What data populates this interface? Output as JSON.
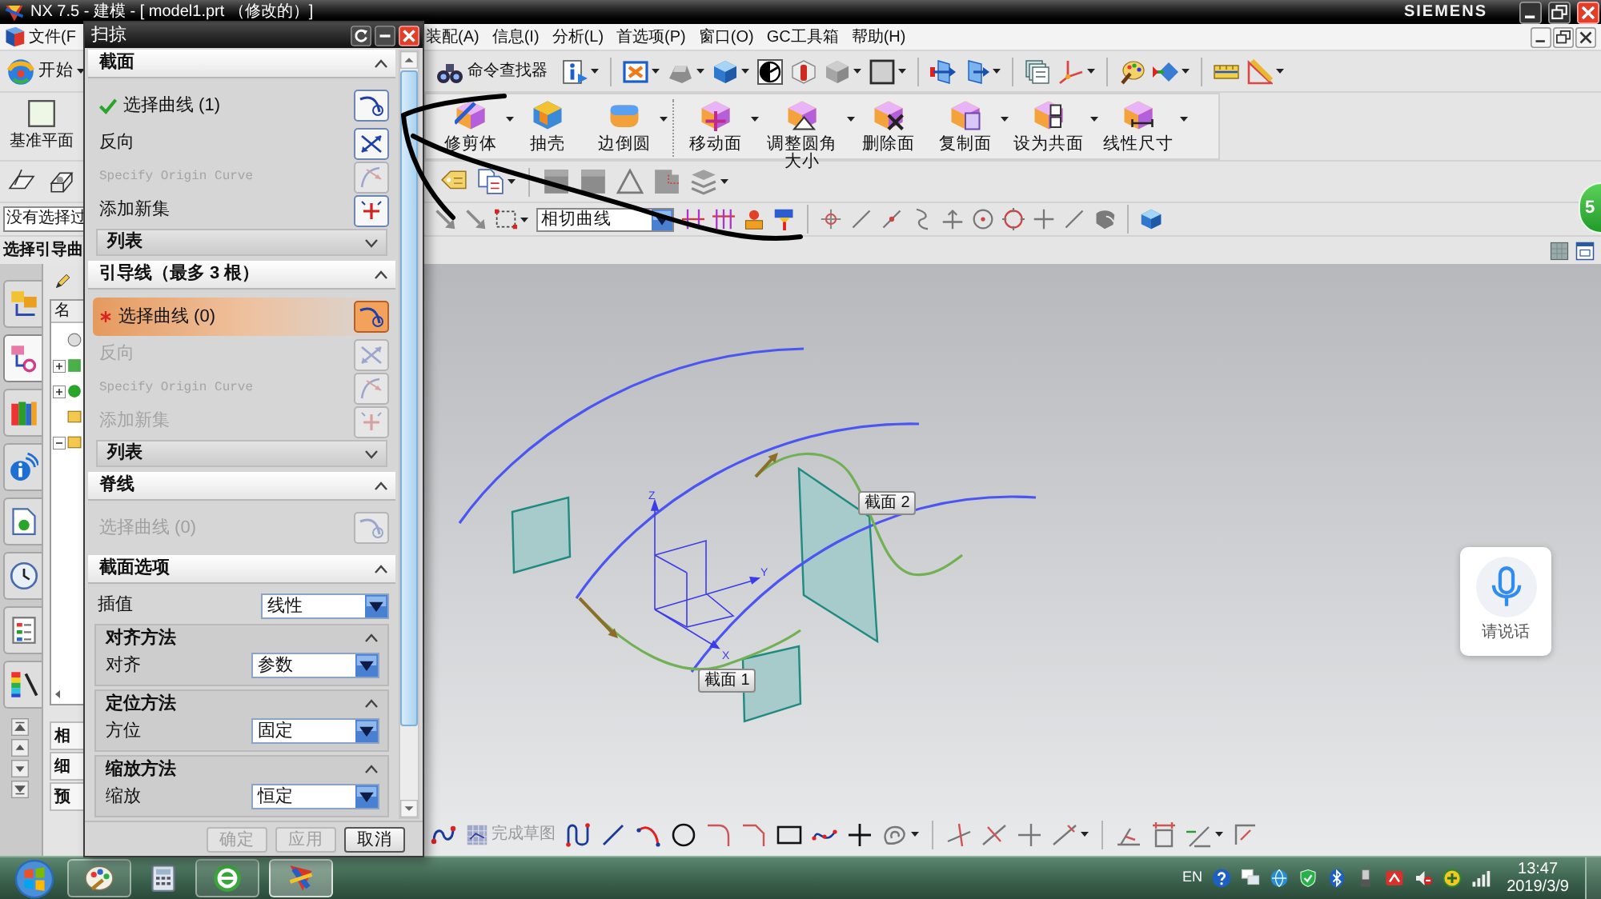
{
  "window": {
    "title": "NX 7.5 - 建模 - [ model1.prt （修改的）]",
    "brand": "SIEMENS"
  },
  "menu": [
    "文件(F",
    "装配(A)",
    "信息(I)",
    "分析(L)",
    "首选项(P)",
    "窗口(O)",
    "GC工具箱",
    "帮助(H)"
  ],
  "toolbar": {
    "start": "开始",
    "command_finder": "命令查找器"
  },
  "features": {
    "left": [
      "基准平面"
    ],
    "right": [
      "修剪体",
      "抽壳",
      "边倒圆",
      "移动面",
      "调整圆角大小",
      "删除面",
      "复制面",
      "设为共面",
      "线性尺寸"
    ]
  },
  "selection_bar": {
    "filter": "没有选择过",
    "curve_rule": "相切曲线"
  },
  "cue": "选择引导曲",
  "resource_tabs": [
    {
      "selected": false
    },
    {
      "selected": true
    },
    {
      "selected": false
    },
    {
      "selected": false
    },
    {
      "selected": false
    },
    {
      "selected": false
    },
    {
      "selected": false
    },
    {
      "selected": false
    }
  ],
  "navigator": {
    "column": "名",
    "nodes": [
      {
        "kind": "leaf"
      },
      {
        "kind": "branch",
        "expanded": false
      },
      {
        "kind": "branch",
        "expanded": false
      },
      {
        "kind": "leaf"
      },
      {
        "kind": "branch",
        "expanded": true
      }
    ],
    "panels": [
      "相",
      "细",
      "预"
    ]
  },
  "dialog": {
    "title": "扫掠",
    "sections": [
      {
        "title": "截面",
        "expanded": true,
        "rows": [
          {
            "kind": "select",
            "label": "选择曲线 (1)",
            "done": true,
            "required": false,
            "active": false,
            "disabled": false
          },
          {
            "kind": "reverse",
            "label": "反向",
            "disabled": false
          },
          {
            "kind": "origin",
            "label": "Specify Origin Curve",
            "disabled": true
          },
          {
            "kind": "add_set",
            "label": "添加新集",
            "disabled": false
          },
          {
            "kind": "list",
            "label": "列表",
            "expanded": false
          }
        ]
      },
      {
        "title": "引导线（最多 3 根）",
        "expanded": true,
        "rows": [
          {
            "kind": "select",
            "label": "选择曲线 (0)",
            "done": false,
            "required": true,
            "active": true,
            "disabled": false
          },
          {
            "kind": "reverse",
            "label": "反向",
            "disabled": true
          },
          {
            "kind": "origin",
            "label": "Specify Origin Curve",
            "disabled": true
          },
          {
            "kind": "add_set",
            "label": "添加新集",
            "disabled": true
          },
          {
            "kind": "list",
            "label": "列表",
            "expanded": false
          }
        ]
      },
      {
        "title": "脊线",
        "expanded": true,
        "rows": [
          {
            "kind": "select",
            "label": "选择曲线 (0)",
            "done": false,
            "required": false,
            "active": false,
            "disabled": true
          }
        ]
      },
      {
        "title": "截面选项",
        "expanded": true,
        "rows": [
          {
            "kind": "dropdown",
            "label": "插值",
            "value": "线性"
          },
          {
            "kind": "group",
            "title": "对齐方法",
            "expanded": true,
            "rows": [
              {
                "kind": "dropdown",
                "label": "对齐",
                "value": "参数"
              }
            ]
          },
          {
            "kind": "group",
            "title": "定位方法",
            "expanded": true,
            "rows": [
              {
                "kind": "dropdown",
                "label": "方位",
                "value": "固定"
              }
            ]
          },
          {
            "kind": "group",
            "title": "缩放方法",
            "expanded": true,
            "rows": [
              {
                "kind": "dropdown",
                "label": "缩放",
                "value": "恒定"
              }
            ]
          }
        ]
      }
    ],
    "buttons": [
      {
        "label": "确定",
        "disabled": true
      },
      {
        "label": "应用",
        "disabled": true
      },
      {
        "label": "取消",
        "disabled": false
      }
    ]
  },
  "canvas": {
    "axes": [
      "Z",
      "Y",
      "X"
    ],
    "section_labels": [
      "截面 1",
      "截面 2"
    ]
  },
  "voice": {
    "label": "请说话"
  },
  "side_badge": {
    "text": "5"
  },
  "sketch_toolbar": {
    "finish": "完成草图",
    "finish_disabled": true
  },
  "taskbar": {
    "apps": [
      {
        "running": true,
        "selected": false
      },
      {
        "running": false,
        "selected": false
      },
      {
        "running": true,
        "selected": false
      },
      {
        "running": true,
        "selected": true
      }
    ],
    "language": "EN",
    "time": "13:47",
    "date": "2019/3/9"
  }
}
